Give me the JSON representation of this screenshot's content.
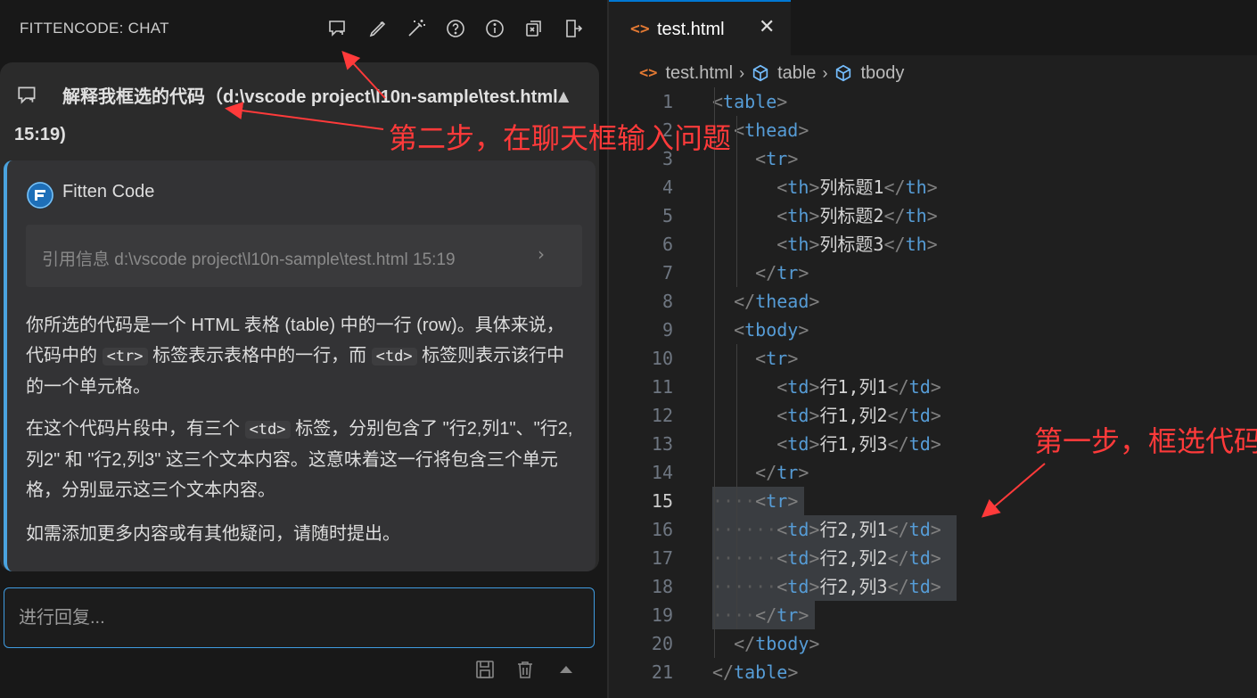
{
  "chat": {
    "title": "FITTENCODE: CHAT",
    "toolbar_icons": [
      "new-chat-icon",
      "edit-icon",
      "magic-wand-icon",
      "help-icon",
      "info-icon",
      "export-icon",
      "exit-icon"
    ],
    "question": "解释我框选的代码（d:\\vscode project\\l10n-sample\\test.html 15:19)",
    "assistant_name": "Fitten Code",
    "reference": "引用信息 d:\\vscode project\\l10n-sample\\test.html 15:19",
    "answer": {
      "p1_a": "你所选的代码是一个 HTML 表格 (table) 中的一行 (row)。具体来说，代码中的 ",
      "p1_code1": "<tr>",
      "p1_b": " 标签表示表格中的一行，而 ",
      "p1_code2": "<td>",
      "p1_c": " 标签则表示该行中的一个单元格。",
      "p2_a": "在这个代码片段中，有三个 ",
      "p2_code": "<td>",
      "p2_b": " 标签，分别包含了 \"行2,列1\"、\"行2,列2\" 和 \"行2,列3\" 这三个文本内容。这意味着这一行将包含三个单元格，分别显示这三个文本内容。",
      "p3": "如需添加更多内容或有其他疑问，请随时提出。"
    },
    "reply_placeholder": "进行回复...",
    "bottom_icons": [
      "save-icon",
      "delete-icon",
      "collapse-icon"
    ]
  },
  "editor": {
    "tab_label": "test.html",
    "tab_icon": "<>",
    "breadcrumb": [
      "test.html",
      "table",
      "tbody"
    ],
    "active_line": 15,
    "lines": [
      {
        "n": "1",
        "indent": 0,
        "parts": [
          [
            "br",
            "<"
          ],
          [
            "tag",
            "table"
          ],
          [
            "br",
            ">"
          ]
        ]
      },
      {
        "n": "2",
        "indent": 1,
        "parts": [
          [
            "br",
            "<"
          ],
          [
            "tag",
            "thead"
          ],
          [
            "br",
            ">"
          ]
        ]
      },
      {
        "n": "3",
        "indent": 2,
        "parts": [
          [
            "br",
            "<"
          ],
          [
            "tag",
            "tr"
          ],
          [
            "br",
            ">"
          ]
        ]
      },
      {
        "n": "4",
        "indent": 3,
        "parts": [
          [
            "br",
            "<"
          ],
          [
            "tag",
            "th"
          ],
          [
            "br",
            ">"
          ],
          [
            "txt",
            "列标题1"
          ],
          [
            "br",
            "</"
          ],
          [
            "tag",
            "th"
          ],
          [
            "br",
            ">"
          ]
        ]
      },
      {
        "n": "5",
        "indent": 3,
        "parts": [
          [
            "br",
            "<"
          ],
          [
            "tag",
            "th"
          ],
          [
            "br",
            ">"
          ],
          [
            "txt",
            "列标题2"
          ],
          [
            "br",
            "</"
          ],
          [
            "tag",
            "th"
          ],
          [
            "br",
            ">"
          ]
        ]
      },
      {
        "n": "6",
        "indent": 3,
        "parts": [
          [
            "br",
            "<"
          ],
          [
            "tag",
            "th"
          ],
          [
            "br",
            ">"
          ],
          [
            "txt",
            "列标题3"
          ],
          [
            "br",
            "</"
          ],
          [
            "tag",
            "th"
          ],
          [
            "br",
            ">"
          ]
        ]
      },
      {
        "n": "7",
        "indent": 2,
        "parts": [
          [
            "br",
            "</"
          ],
          [
            "tag",
            "tr"
          ],
          [
            "br",
            ">"
          ]
        ]
      },
      {
        "n": "8",
        "indent": 1,
        "parts": [
          [
            "br",
            "</"
          ],
          [
            "tag",
            "thead"
          ],
          [
            "br",
            ">"
          ]
        ]
      },
      {
        "n": "9",
        "indent": 1,
        "parts": [
          [
            "br",
            "<"
          ],
          [
            "tag",
            "tbody"
          ],
          [
            "br",
            ">"
          ]
        ]
      },
      {
        "n": "10",
        "indent": 2,
        "parts": [
          [
            "br",
            "<"
          ],
          [
            "tag",
            "tr"
          ],
          [
            "br",
            ">"
          ]
        ]
      },
      {
        "n": "11",
        "indent": 3,
        "parts": [
          [
            "br",
            "<"
          ],
          [
            "tag",
            "td"
          ],
          [
            "br",
            ">"
          ],
          [
            "txt",
            "行1,列1"
          ],
          [
            "br",
            "</"
          ],
          [
            "tag",
            "td"
          ],
          [
            "br",
            ">"
          ]
        ]
      },
      {
        "n": "12",
        "indent": 3,
        "parts": [
          [
            "br",
            "<"
          ],
          [
            "tag",
            "td"
          ],
          [
            "br",
            ">"
          ],
          [
            "txt",
            "行1,列2"
          ],
          [
            "br",
            "</"
          ],
          [
            "tag",
            "td"
          ],
          [
            "br",
            ">"
          ]
        ]
      },
      {
        "n": "13",
        "indent": 3,
        "parts": [
          [
            "br",
            "<"
          ],
          [
            "tag",
            "td"
          ],
          [
            "br",
            ">"
          ],
          [
            "txt",
            "行1,列3"
          ],
          [
            "br",
            "</"
          ],
          [
            "tag",
            "td"
          ],
          [
            "br",
            ">"
          ]
        ]
      },
      {
        "n": "14",
        "indent": 2,
        "parts": [
          [
            "br",
            "</"
          ],
          [
            "tag",
            "tr"
          ],
          [
            "br",
            ">"
          ]
        ]
      },
      {
        "n": "15",
        "indent": 2,
        "sel": true,
        "parts": [
          [
            "br",
            "<"
          ],
          [
            "tag",
            "tr"
          ],
          [
            "br",
            ">"
          ]
        ]
      },
      {
        "n": "16",
        "indent": 3,
        "sel": true,
        "parts": [
          [
            "br",
            "<"
          ],
          [
            "tag",
            "td"
          ],
          [
            "br",
            ">"
          ],
          [
            "txt",
            "行2,列1"
          ],
          [
            "br",
            "</"
          ],
          [
            "tag",
            "td"
          ],
          [
            "br",
            ">"
          ]
        ]
      },
      {
        "n": "17",
        "indent": 3,
        "sel": true,
        "parts": [
          [
            "br",
            "<"
          ],
          [
            "tag",
            "td"
          ],
          [
            "br",
            ">"
          ],
          [
            "txt",
            "行2,列2"
          ],
          [
            "br",
            "</"
          ],
          [
            "tag",
            "td"
          ],
          [
            "br",
            ">"
          ]
        ]
      },
      {
        "n": "18",
        "indent": 3,
        "sel": true,
        "parts": [
          [
            "br",
            "<"
          ],
          [
            "tag",
            "td"
          ],
          [
            "br",
            ">"
          ],
          [
            "txt",
            "行2,列3"
          ],
          [
            "br",
            "</"
          ],
          [
            "tag",
            "td"
          ],
          [
            "br",
            ">"
          ]
        ]
      },
      {
        "n": "19",
        "indent": 2,
        "sel": true,
        "parts": [
          [
            "br",
            "</"
          ],
          [
            "tag",
            "tr"
          ],
          [
            "br",
            ">"
          ]
        ]
      },
      {
        "n": "20",
        "indent": 1,
        "parts": [
          [
            "br",
            "</"
          ],
          [
            "tag",
            "tbody"
          ],
          [
            "br",
            ">"
          ]
        ]
      },
      {
        "n": "21",
        "indent": 0,
        "parts": [
          [
            "br",
            "</"
          ],
          [
            "tag",
            "table"
          ],
          [
            "br",
            ">"
          ]
        ]
      }
    ]
  },
  "annotations": {
    "step2": "第二步，在聊天框输入问题",
    "step1": "第一步，框选代码",
    "color": "#ff3a3a"
  },
  "colors": {
    "accent": "#0078d4",
    "tag": "#569cd6",
    "file_icon": "#e37933",
    "selection": "#3a3d41"
  }
}
